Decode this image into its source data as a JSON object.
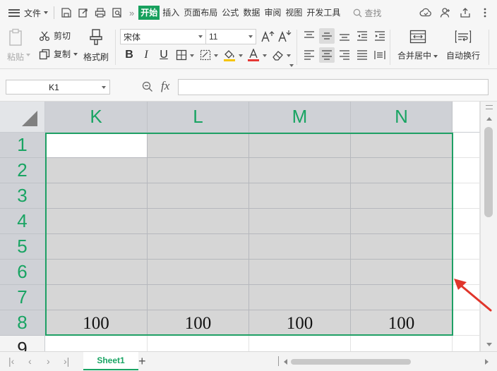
{
  "colors": {
    "accent": "#17a05d",
    "header_green": "#19a463",
    "selection_fill": "#d6d6d6",
    "header_gray": "#cfd1d6",
    "annotation_red": "#e0352b"
  },
  "menubar": {
    "file": "文件",
    "quick_icons": [
      "save-icon",
      "export-icon",
      "print-icon",
      "preview-icon"
    ],
    "more": "»",
    "tabs": [
      {
        "label": "开始",
        "active": true
      },
      {
        "label": "插入"
      },
      {
        "label": "页面布局"
      },
      {
        "label": "公式"
      },
      {
        "label": "数据"
      },
      {
        "label": "审阅"
      },
      {
        "label": "视图"
      },
      {
        "label": "开发工具"
      }
    ],
    "search": "查找",
    "right_icons": [
      "cloud-sync-icon",
      "user-share-icon",
      "share-icon",
      "more-icon"
    ]
  },
  "ribbon": {
    "paste": "粘贴",
    "cut": "剪切",
    "copy": "复制",
    "format_painter": "格式刷",
    "font_name": "宋体",
    "font_size": "11",
    "bold": "B",
    "italic": "I",
    "underline": "U",
    "merge_center": "合并居中",
    "wrap_text": "自动换行"
  },
  "formula_bar": {
    "name_box": "K1",
    "fx": "fx",
    "formula": ""
  },
  "sheet": {
    "columns": [
      "K",
      "L",
      "M",
      "N"
    ],
    "rows": [
      "1",
      "2",
      "3",
      "4",
      "5",
      "6",
      "7",
      "8",
      "9"
    ],
    "row8_values": [
      "100",
      "100",
      "100",
      "100"
    ]
  },
  "sheetbar": {
    "tab": "Sheet1",
    "add": "+"
  }
}
